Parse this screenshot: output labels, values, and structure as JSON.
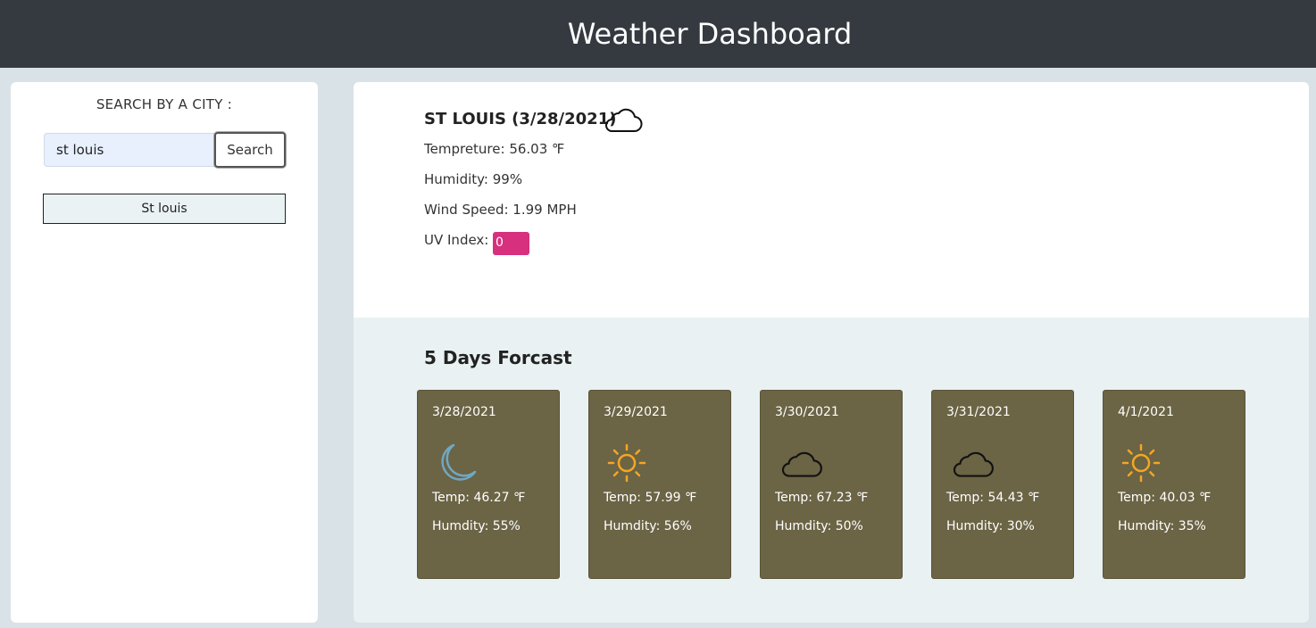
{
  "header": {
    "title": "Weather Dashboard"
  },
  "sidebar": {
    "search_label": "SEARCH BY A CITY :",
    "search_value": "st louis",
    "search_button": "Search",
    "history": [
      "St louis"
    ]
  },
  "current": {
    "city_title": "ST LOUIS (3/28/2021)",
    "icon": "cloud-icon",
    "temperature": "Tempreture: 56.03 ℉",
    "humidity": "Humidity: 99%",
    "wind": "Wind Speed: 1.99 MPH",
    "uv_label": "UV Index:",
    "uv_value": "0",
    "uv_color": "#d6307e"
  },
  "forecast": {
    "title": "5 Days Forcast",
    "card_color": "#6b6445",
    "days": [
      {
        "date": "3/28/2021",
        "icon": "moon-icon",
        "temp": "Temp: 46.27 ℉",
        "humidity": "Humdity: 55%"
      },
      {
        "date": "3/29/2021",
        "icon": "sun-icon",
        "temp": "Temp: 57.99 ℉",
        "humidity": "Humdity: 56%"
      },
      {
        "date": "3/30/2021",
        "icon": "cloud-icon",
        "temp": "Temp: 67.23 ℉",
        "humidity": "Humdity: 50%"
      },
      {
        "date": "3/31/2021",
        "icon": "cloud-icon",
        "temp": "Temp: 54.43 ℉",
        "humidity": "Humdity: 30%"
      },
      {
        "date": "4/1/2021",
        "icon": "sun-icon",
        "temp": "Temp: 40.03 ℉",
        "humidity": "Humdity: 35%"
      }
    ]
  }
}
